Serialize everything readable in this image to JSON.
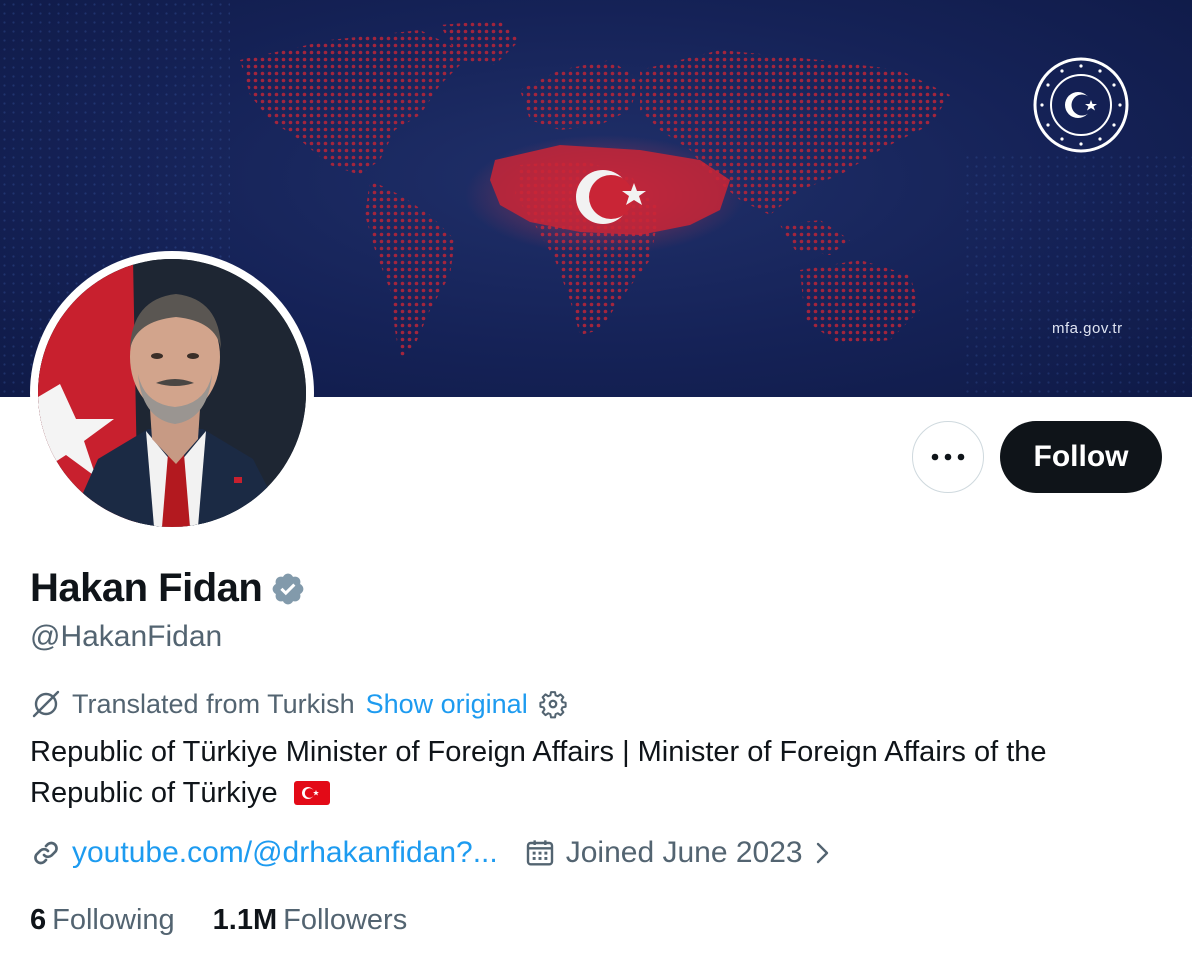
{
  "banner": {
    "site_label": "mfa.gov.tr",
    "colors": {
      "background": "#152257",
      "map": "#c0273a"
    },
    "seal_icon": "mfa-seal-icon"
  },
  "profile": {
    "name": "Hakan Fidan",
    "handle": "@HakanFidan",
    "verified": true,
    "verified_color": "#829aab"
  },
  "actions": {
    "more_icon": "more-options-icon",
    "follow_label": "Follow"
  },
  "translation": {
    "text": "Translated from Turkish",
    "show_original_label": "Show original",
    "icon": "translate-icon",
    "settings_icon": "gear-icon"
  },
  "bio": {
    "text": "Republic of Türkiye Minister of Foreign Affairs | Minister of Foreign Affairs of the Republic of Türkiye",
    "flag_icon": "turkey-flag-icon"
  },
  "meta": {
    "website": "youtube.com/@drhakanfidan?...",
    "joined": "Joined June 2023"
  },
  "stats": {
    "following_count": "6",
    "following_label": "Following",
    "followers_count": "1.1M",
    "followers_label": "Followers"
  },
  "colors": {
    "accent": "#1d9bf0",
    "text": "#0f1419",
    "secondary": "#536471"
  }
}
